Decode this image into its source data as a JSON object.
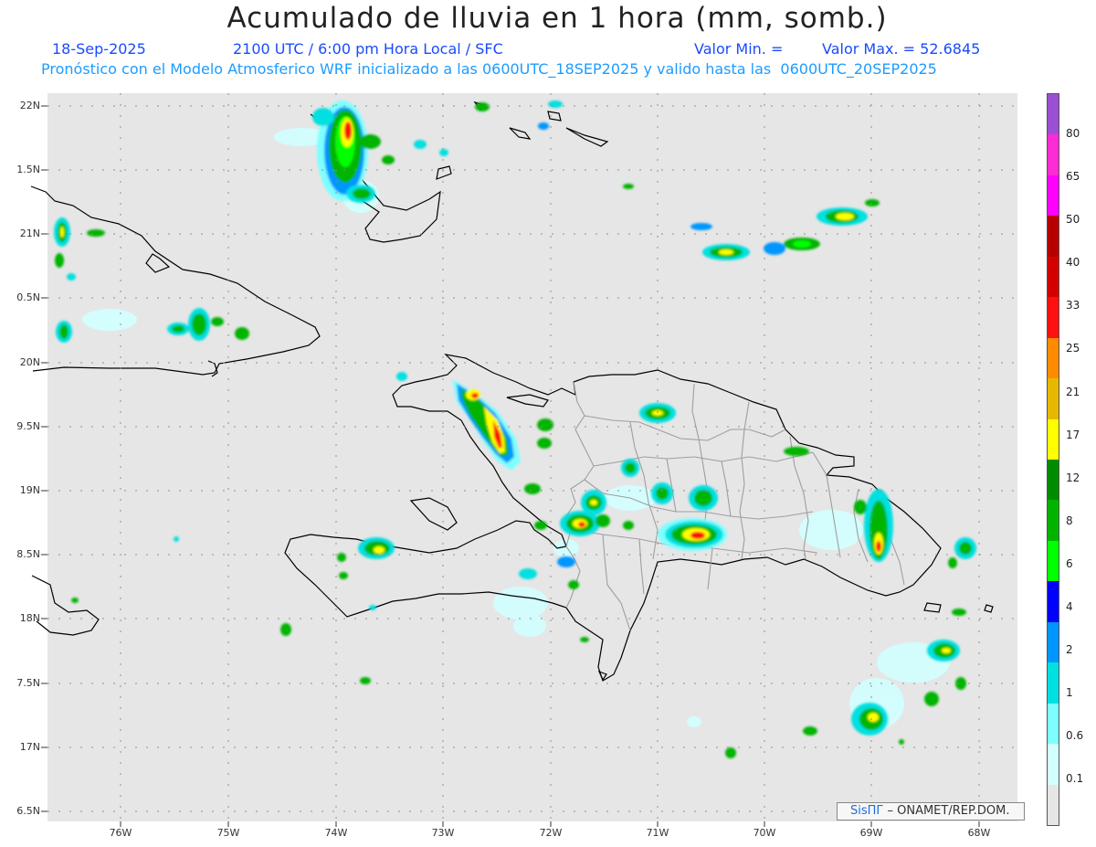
{
  "header": {
    "title": "Acumulado de lluvia en 1 hora (mm, somb.)",
    "date": "18-Sep-2025",
    "time_info": "2100 UTC / 6:00 pm Hora Local / SFC",
    "valor_min": "Valor Min. =",
    "valor_max": "Valor Max. = 52.6845",
    "model_info": "Pronóstico con el Modelo Atmosferico WRF inicializado a las 0600UTC_18SEP2025 y valido hasta las  0600UTC_20SEP2025"
  },
  "axes": {
    "lat_labels": [
      "22N",
      "1.5N",
      "21N",
      "0.5N",
      "20N",
      "9.5N",
      "19N",
      "8.5N",
      "18N",
      "7.5N",
      "17N",
      "6.5N"
    ],
    "lon_labels": [
      "76W",
      "75W",
      "74W",
      "73W",
      "72W",
      "71W",
      "70W",
      "69W",
      "68W"
    ]
  },
  "colorbar": {
    "labels": [
      "80",
      "65",
      "50",
      "40",
      "33",
      "25",
      "21",
      "17",
      "12",
      "8",
      "6",
      "4",
      "2",
      "1",
      "0.6",
      "0.1"
    ],
    "colors": [
      "#9b4fd3",
      "#ff2bd4",
      "#ff00ff",
      "#b70000",
      "#d40000",
      "#ff1010",
      "#ff8c00",
      "#e6b800",
      "#ffff00",
      "#008c00",
      "#00b400",
      "#00ff00",
      "#0000ff",
      "#0096ff",
      "#00e0e0",
      "#7dffff",
      "#d2ffff",
      "#e6e6e6"
    ]
  },
  "credit": {
    "brand": "SisПГ",
    "text": " – ONAMET/REP.DOM."
  },
  "map_colors": {
    "background": "#e6e6e6",
    "coast": "#000000",
    "borders": "#9e9e9e",
    "grid": "#909090"
  }
}
